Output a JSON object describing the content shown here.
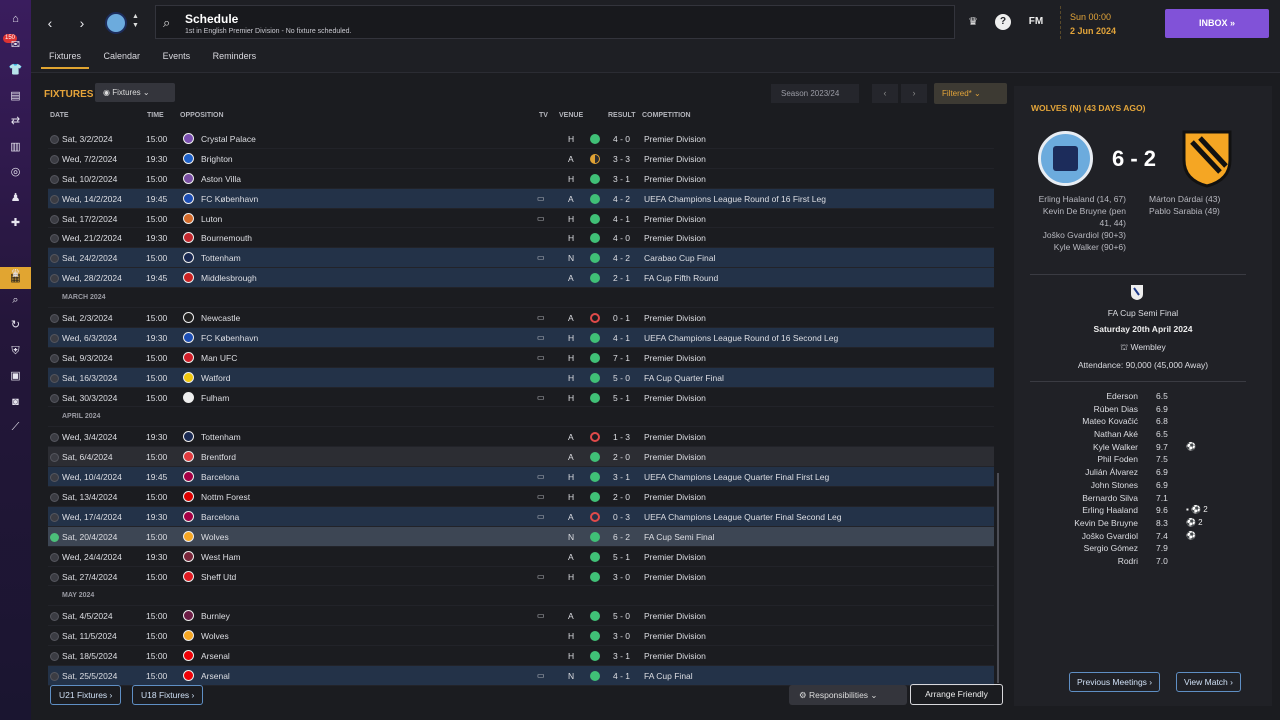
{
  "rail": {
    "badge": "150",
    "icons": [
      "home-icon",
      "inbox-icon",
      "squad-icon",
      "clipboard-icon",
      "transfers-icon",
      "calendar-icon",
      "scouting-icon",
      "staff-icon",
      "medical-icon",
      "schedule-icon",
      "trophy-icon",
      "search-icon",
      "swap-icon",
      "shield-icon",
      "briefcase-icon",
      "card-icon",
      "chart-icon"
    ]
  },
  "header": {
    "title": "Schedule",
    "subtitle": "1st in English Premier Division - No fixture scheduled.",
    "date_time": "Sun 00:00",
    "date": "2 Jun 2024",
    "inbox_label": "INBOX",
    "fm_label": "FM",
    "help_label": "?"
  },
  "tabs": [
    "Fixtures",
    "Calendar",
    "Events",
    "Reminders"
  ],
  "main": {
    "title": "FIXTURES",
    "view_dropdown": "Fixtures",
    "season": "Season 2023/24",
    "filter": "Filtered*",
    "columns": {
      "date": "DATE",
      "time": "TIME",
      "opposition": "OPPOSITION",
      "tv": "TV",
      "venue": "VENUE",
      "result": "RESULT",
      "competition": "COMPETITION"
    },
    "rows": [
      {
        "kind": "match",
        "date": "Sat, 3/2/2024",
        "time": "15:00",
        "opp": "Crystal Palace",
        "crest": "#7b4fb0",
        "tv": "",
        "venue": "H",
        "res": "w",
        "score": "4 - 0",
        "comp": "Premier Division",
        "style": ""
      },
      {
        "kind": "match",
        "date": "Wed, 7/2/2024",
        "time": "19:30",
        "opp": "Brighton",
        "crest": "#1f62c9",
        "tv": "",
        "venue": "A",
        "res": "d",
        "score": "3 - 3",
        "comp": "Premier Division",
        "style": ""
      },
      {
        "kind": "match",
        "date": "Sat, 10/2/2024",
        "time": "15:00",
        "opp": "Aston Villa",
        "crest": "#7a4fa3",
        "tv": "",
        "venue": "H",
        "res": "w",
        "score": "3 - 1",
        "comp": "Premier Division",
        "style": ""
      },
      {
        "kind": "match",
        "date": "Wed, 14/2/2024",
        "time": "19:45",
        "opp": "FC København",
        "crest": "#1d4fb5",
        "tv": "tv",
        "venue": "A",
        "res": "w",
        "score": "4 - 2",
        "comp": "UEFA Champions League Round of 16  First Leg",
        "style": "hl"
      },
      {
        "kind": "match",
        "date": "Sat, 17/2/2024",
        "time": "15:00",
        "opp": "Luton",
        "crest": "#d36a2a",
        "tv": "tv",
        "venue": "H",
        "res": "w",
        "score": "4 - 1",
        "comp": "Premier Division",
        "style": ""
      },
      {
        "kind": "match",
        "date": "Wed, 21/2/2024",
        "time": "19:30",
        "opp": "Bournemouth",
        "crest": "#c3282e",
        "tv": "",
        "venue": "H",
        "res": "w",
        "score": "4 - 0",
        "comp": "Premier Division",
        "style": ""
      },
      {
        "kind": "match",
        "date": "Sat, 24/2/2024",
        "time": "15:00",
        "opp": "Tottenham",
        "crest": "#1a2a52",
        "tv": "tv",
        "venue": "N",
        "res": "w",
        "score": "4 - 2",
        "comp": "Carabao Cup Final",
        "style": "hl"
      },
      {
        "kind": "match",
        "date": "Wed, 28/2/2024",
        "time": "19:45",
        "opp": "Middlesbrough",
        "crest": "#c22",
        "tv": "",
        "venue": "A",
        "res": "w",
        "score": "2 - 1",
        "comp": "FA Cup Fifth Round",
        "style": "hl"
      },
      {
        "kind": "month",
        "label": "MARCH 2024"
      },
      {
        "kind": "match",
        "date": "Sat, 2/3/2024",
        "time": "15:00",
        "opp": "Newcastle",
        "crest": "#222",
        "tv": "tv",
        "venue": "A",
        "res": "l",
        "score": "0 - 1",
        "comp": "Premier Division",
        "style": ""
      },
      {
        "kind": "match",
        "date": "Wed, 6/3/2024",
        "time": "19:30",
        "opp": "FC København",
        "crest": "#1d4fb5",
        "tv": "tv",
        "venue": "H",
        "res": "w",
        "score": "4 - 1",
        "comp": "UEFA Champions League Round of 16  Second Leg",
        "style": "hl"
      },
      {
        "kind": "match",
        "date": "Sat, 9/3/2024",
        "time": "15:00",
        "opp": "Man UFC",
        "crest": "#d11f2a",
        "tv": "tv",
        "venue": "H",
        "res": "w",
        "score": "7 - 1",
        "comp": "Premier Division",
        "style": ""
      },
      {
        "kind": "match",
        "date": "Sat, 16/3/2024",
        "time": "15:00",
        "opp": "Watford",
        "crest": "#f2c80f",
        "tv": "",
        "venue": "H",
        "res": "w",
        "score": "5 - 0",
        "comp": "FA Cup Quarter Final",
        "style": "hl"
      },
      {
        "kind": "match",
        "date": "Sat, 30/3/2024",
        "time": "15:00",
        "opp": "Fulham",
        "crest": "#eee",
        "tv": "tv",
        "venue": "H",
        "res": "w",
        "score": "5 - 1",
        "comp": "Premier Division",
        "style": ""
      },
      {
        "kind": "month",
        "label": "APRIL 2024"
      },
      {
        "kind": "match",
        "date": "Wed, 3/4/2024",
        "time": "19:30",
        "opp": "Tottenham",
        "crest": "#1a2a52",
        "tv": "",
        "venue": "A",
        "res": "l",
        "score": "1 - 3",
        "comp": "Premier Division",
        "style": ""
      },
      {
        "kind": "match",
        "date": "Sat, 6/4/2024",
        "time": "15:00",
        "opp": "Brentford",
        "crest": "#e03a3e",
        "tv": "",
        "venue": "A",
        "res": "w",
        "score": "2 - 0",
        "comp": "Premier Division",
        "style": "gray"
      },
      {
        "kind": "match",
        "date": "Wed, 10/4/2024",
        "time": "19:45",
        "opp": "Barcelona",
        "crest": "#a50044",
        "tv": "tv",
        "venue": "H",
        "res": "w",
        "score": "3 - 1",
        "comp": "UEFA Champions League Quarter Final First Leg",
        "style": "hl"
      },
      {
        "kind": "match",
        "date": "Sat, 13/4/2024",
        "time": "15:00",
        "opp": "Nottm Forest",
        "crest": "#dd0000",
        "tv": "tv",
        "venue": "H",
        "res": "w",
        "score": "2 - 0",
        "comp": "Premier Division",
        "style": ""
      },
      {
        "kind": "match",
        "date": "Wed, 17/4/2024",
        "time": "19:30",
        "opp": "Barcelona",
        "crest": "#a50044",
        "tv": "tv",
        "venue": "A",
        "res": "l",
        "score": "0 - 3",
        "comp": "UEFA Champions League Quarter Final Second Leg",
        "style": "hl"
      },
      {
        "kind": "match",
        "date": "Sat, 20/4/2024",
        "time": "15:00",
        "opp": "Wolves",
        "crest": "#f5a623",
        "tv": "",
        "venue": "N",
        "res": "w",
        "score": "6 - 2",
        "comp": "FA Cup Semi Final",
        "style": "sel"
      },
      {
        "kind": "match",
        "date": "Wed, 24/4/2024",
        "time": "19:30",
        "opp": "West Ham",
        "crest": "#7a263a",
        "tv": "",
        "venue": "A",
        "res": "w",
        "score": "5 - 1",
        "comp": "Premier Division",
        "style": ""
      },
      {
        "kind": "match",
        "date": "Sat, 27/4/2024",
        "time": "15:00",
        "opp": "Sheff Utd",
        "crest": "#e01a22",
        "tv": "tv",
        "venue": "H",
        "res": "w",
        "score": "3 - 0",
        "comp": "Premier Division",
        "style": ""
      },
      {
        "kind": "month",
        "label": "MAY 2024"
      },
      {
        "kind": "match",
        "date": "Sat, 4/5/2024",
        "time": "15:00",
        "opp": "Burnley",
        "crest": "#6c1d45",
        "tv": "tv",
        "venue": "A",
        "res": "w",
        "score": "5 - 0",
        "comp": "Premier Division",
        "style": ""
      },
      {
        "kind": "match",
        "date": "Sat, 11/5/2024",
        "time": "15:00",
        "opp": "Wolves",
        "crest": "#f5a623",
        "tv": "",
        "venue": "H",
        "res": "w",
        "score": "3 - 0",
        "comp": "Premier Division",
        "style": ""
      },
      {
        "kind": "match",
        "date": "Sat, 18/5/2024",
        "time": "15:00",
        "opp": "Arsenal",
        "crest": "#ef0107",
        "tv": "",
        "venue": "H",
        "res": "w",
        "score": "3 - 1",
        "comp": "Premier Division",
        "style": ""
      },
      {
        "kind": "match",
        "date": "Sat, 25/5/2024",
        "time": "15:00",
        "opp": "Arsenal",
        "crest": "#ef0107",
        "tv": "tv",
        "venue": "N",
        "res": "w",
        "score": "4 - 1",
        "comp": "FA Cup Final",
        "style": "hl"
      }
    ],
    "buttons": {
      "u21": "U21 Fixtures",
      "u18": "U18 Fixtures",
      "responsibilities": "Responsibilities",
      "arrange": "Arrange Friendly"
    }
  },
  "side": {
    "heading": "WOLVES (N) (43 DAYS AGO)",
    "score": "6 - 2",
    "home_scorers": [
      "Erling Haaland (14, 67)",
      "Kevin De Bruyne (pen",
      "41, 44)",
      "Joško Gvardiol (90+3)",
      "Kyle Walker (90+6)"
    ],
    "away_scorers": [
      "Márton Dárdai (43)",
      "Pablo Sarabia (49)"
    ],
    "competition": "FA Cup Semi Final",
    "match_date": "Saturday 20th April 2024",
    "venue": "Wembley",
    "attendance": "Attendance: 90,000 (45,000 Away)",
    "lineup": [
      {
        "name": "Ederson",
        "rating": "6.5",
        "events": ""
      },
      {
        "name": "Rúben Dias",
        "rating": "6.9",
        "events": ""
      },
      {
        "name": "Mateo Kovačić",
        "rating": "6.8",
        "events": ""
      },
      {
        "name": "Nathan Aké",
        "rating": "6.5",
        "events": ""
      },
      {
        "name": "Kyle Walker",
        "rating": "9.7",
        "events": "⚽"
      },
      {
        "name": "Phil Foden",
        "rating": "7.5",
        "events": ""
      },
      {
        "name": "Julián Álvarez",
        "rating": "6.9",
        "events": ""
      },
      {
        "name": "John Stones",
        "rating": "6.9",
        "events": ""
      },
      {
        "name": "Bernardo Silva",
        "rating": "7.1",
        "events": ""
      },
      {
        "name": "Erling Haaland",
        "rating": "9.6",
        "events": "▪ ⚽ 2"
      },
      {
        "name": "Kevin De Bruyne",
        "rating": "8.3",
        "events": "⚽ 2"
      },
      {
        "name": "Joško Gvardiol",
        "rating": "7.4",
        "events": "⚽"
      },
      {
        "name": "Sergio Gómez",
        "rating": "7.9",
        "events": ""
      },
      {
        "name": "Rodri",
        "rating": "7.0",
        "events": ""
      }
    ],
    "prev_meetings": "Previous Meetings",
    "view_match": "View Match"
  }
}
